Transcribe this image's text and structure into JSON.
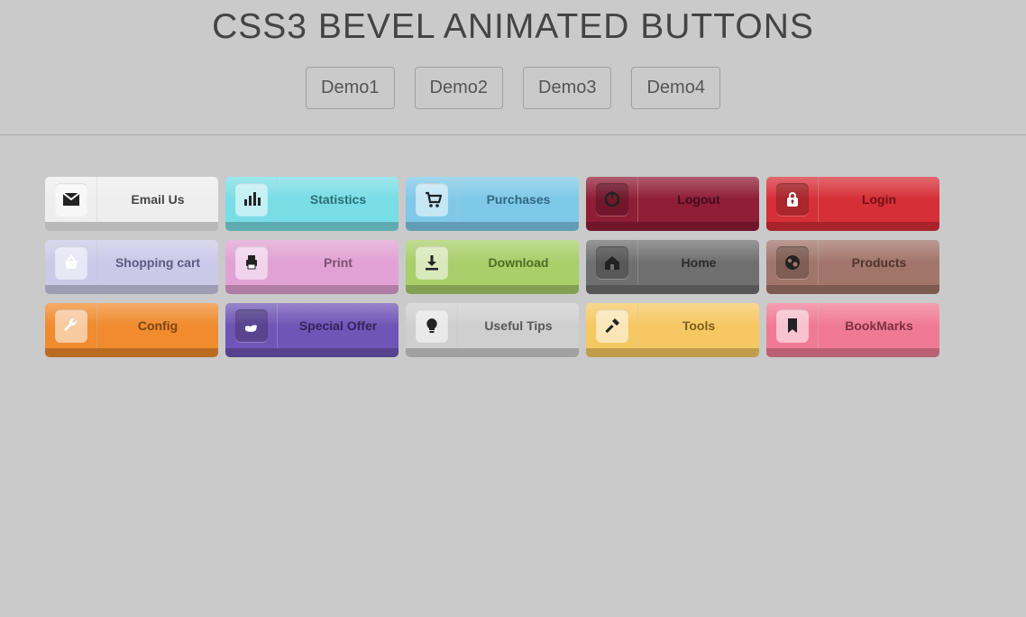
{
  "header": {
    "title": "CSS3 BEVEL ANIMATED BUTTONS",
    "tabs": [
      "Demo1",
      "Demo2",
      "Demo3",
      "Demo4"
    ]
  },
  "buttons": [
    {
      "label": "Email Us",
      "theme": "white",
      "icon": "mail",
      "iconLight": true,
      "iconDark": true
    },
    {
      "label": "Statistics",
      "theme": "cyan",
      "icon": "stats",
      "iconLight": true,
      "iconDark": true
    },
    {
      "label": "Purchases",
      "theme": "sky",
      "icon": "cart",
      "iconLight": true,
      "iconDark": true
    },
    {
      "label": "Logout",
      "theme": "maroon",
      "icon": "power",
      "iconLight": false,
      "iconDark": true
    },
    {
      "label": "Login",
      "theme": "red",
      "icon": "lock",
      "iconLight": false,
      "iconDark": false
    },
    {
      "label": "Shopping cart",
      "theme": "lav",
      "icon": "basket",
      "iconLight": true,
      "iconDark": false
    },
    {
      "label": "Print",
      "theme": "pink",
      "icon": "print",
      "iconLight": true,
      "iconDark": true
    },
    {
      "label": "Download",
      "theme": "lime",
      "icon": "download",
      "iconLight": true,
      "iconDark": true
    },
    {
      "label": "Home",
      "theme": "gray",
      "icon": "home",
      "iconLight": false,
      "iconDark": true
    },
    {
      "label": "Products",
      "theme": "brown",
      "icon": "globe",
      "iconLight": false,
      "iconDark": true
    },
    {
      "label": "Config",
      "theme": "orange",
      "icon": "wrench",
      "iconLight": true,
      "iconDark": false
    },
    {
      "label": "Special Offer",
      "theme": "purple",
      "icon": "hand",
      "iconLight": false,
      "iconDark": false
    },
    {
      "label": "Useful Tips",
      "theme": "silver",
      "icon": "bulb",
      "iconLight": true,
      "iconDark": true
    },
    {
      "label": "Tools",
      "theme": "yellow",
      "icon": "hammer",
      "iconLight": true,
      "iconDark": true
    },
    {
      "label": "BookMarks",
      "theme": "rose",
      "icon": "bookmark",
      "iconLight": true,
      "iconDark": true
    }
  ]
}
